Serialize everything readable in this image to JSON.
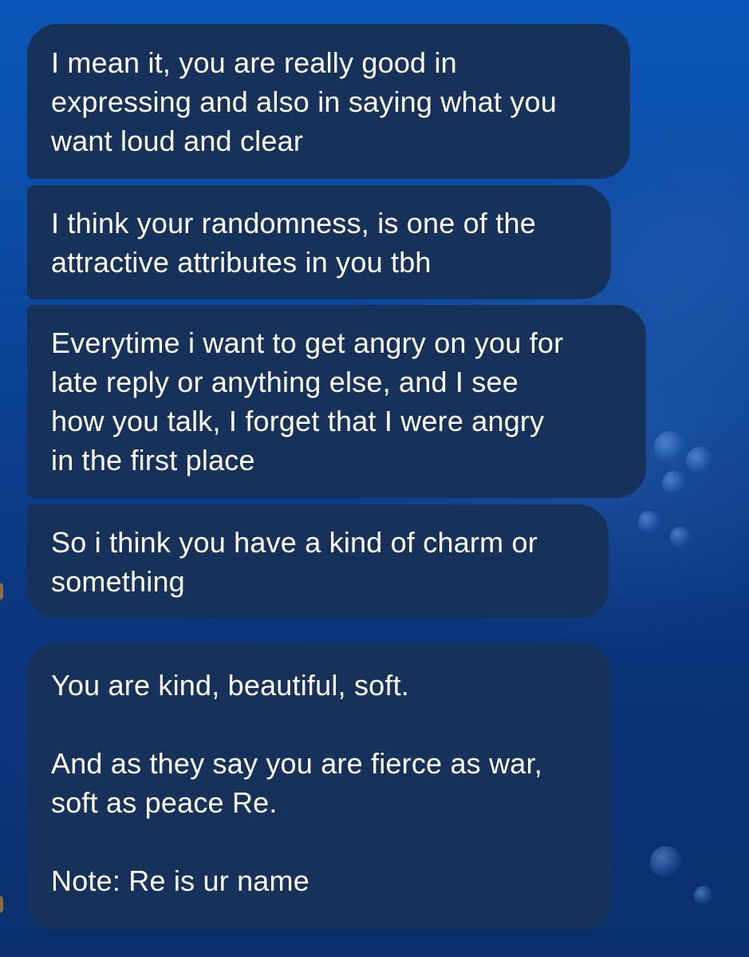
{
  "messages": [
    {
      "text": "I mean it, you are really good in\nexpressing and also in saying what you\nwant loud and clear"
    },
    {
      "text": "I think your randomness, is one of the\nattractive attributes in you tbh"
    },
    {
      "text": "Everytime i want to get angry on you for\nlate reply or anything else, and I see\nhow you talk, I forget that I were angry\nin the first place"
    },
    {
      "text": "So i think you have a kind of charm or\nsomething"
    },
    {
      "paragraphs": [
        "You are kind, beautiful, soft.",
        "And as they say you are fierce as war,\nsoft as peace Re.",
        "Note: Re is ur name"
      ]
    }
  ],
  "colors": {
    "bubble_background": "#17325a",
    "text": "#ffffff",
    "background_accent": "#0a56b8"
  }
}
